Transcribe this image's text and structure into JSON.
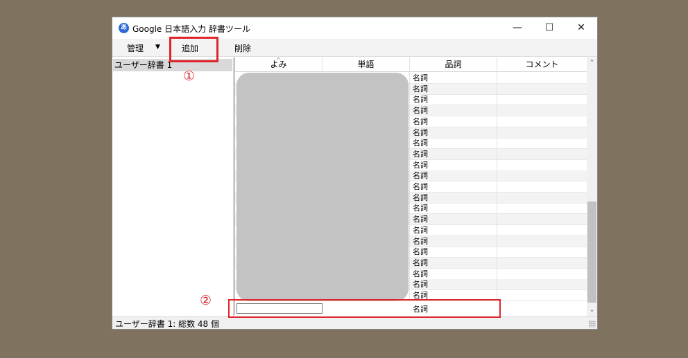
{
  "window": {
    "title": "Google 日本語入力 辞書ツール",
    "app_icon_glyph": "あ",
    "controls": {
      "minimize": "—",
      "maximize": "☐",
      "close": "✕"
    }
  },
  "toolbar": {
    "manage_label": "管理",
    "manage_arrow": "▼",
    "add_label": "追加",
    "delete_label": "削除"
  },
  "sidebar": {
    "items": [
      {
        "label": "ユーザー辞書 1"
      }
    ]
  },
  "grid": {
    "sort_indicator": "^",
    "columns": [
      "よみ",
      "単語",
      "品詞",
      "コメント"
    ],
    "rows": [
      {
        "pos": "名詞"
      },
      {
        "pos": "名詞"
      },
      {
        "pos": "名詞"
      },
      {
        "pos": "名詞"
      },
      {
        "pos": "名詞"
      },
      {
        "pos": "名詞"
      },
      {
        "pos": "名詞"
      },
      {
        "pos": "名詞"
      },
      {
        "pos": "名詞"
      },
      {
        "pos": "名詞"
      },
      {
        "pos": "名詞"
      },
      {
        "pos": "名詞"
      },
      {
        "pos": "名詞"
      },
      {
        "pos": "名詞"
      },
      {
        "pos": "名詞"
      },
      {
        "pos": "名詞"
      },
      {
        "pos": "名詞"
      },
      {
        "pos": "名詞"
      },
      {
        "pos": "名詞"
      },
      {
        "pos": "名詞"
      },
      {
        "pos": "名詞"
      }
    ],
    "new_row": {
      "reading_value": "",
      "pos": "名詞"
    }
  },
  "scrollbar": {
    "up_arrow": "⌃",
    "down_arrow": "⌄"
  },
  "statusbar": {
    "text": "ユーザー辞書 1: 総数 48 個"
  },
  "annotations": {
    "marker_1": "①",
    "marker_2": "②",
    "color": "#e0242b"
  }
}
